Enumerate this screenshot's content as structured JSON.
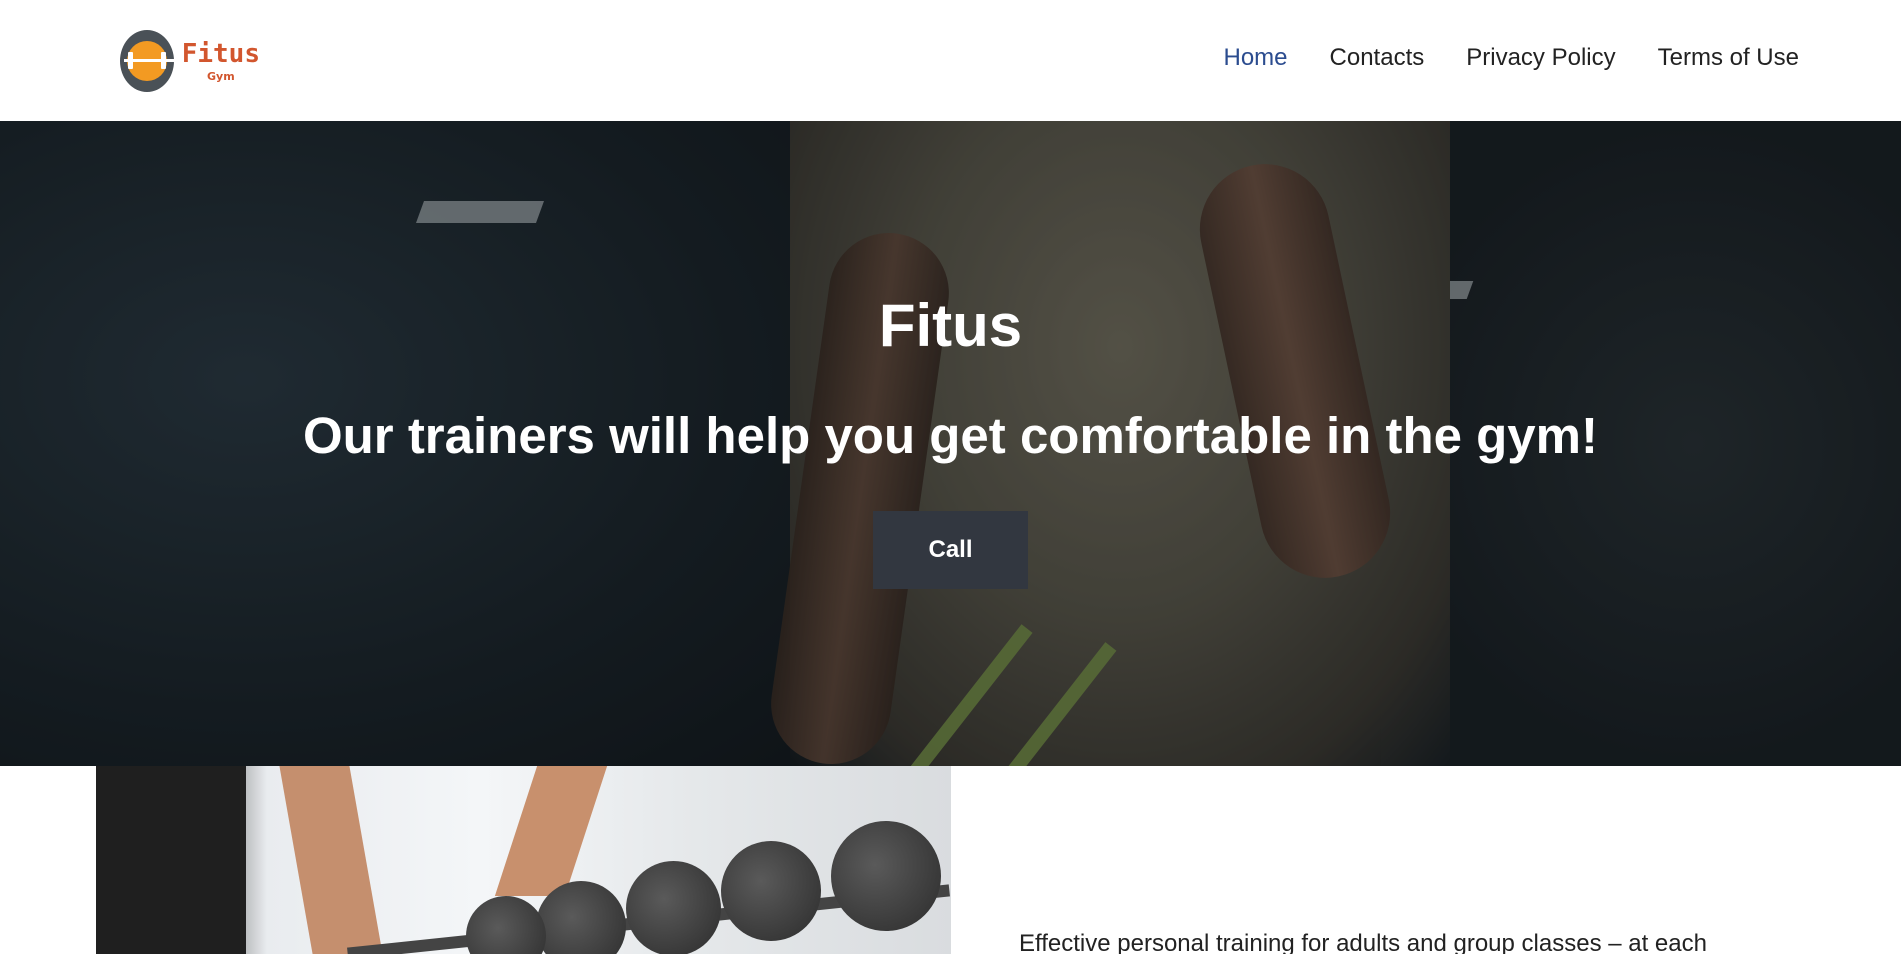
{
  "header": {
    "logo": {
      "name": "Fitus",
      "sub": "Gym"
    },
    "nav": [
      {
        "label": "Home",
        "active": true
      },
      {
        "label": "Contacts",
        "active": false
      },
      {
        "label": "Privacy Policy",
        "active": false
      },
      {
        "label": "Terms of Use",
        "active": false
      }
    ]
  },
  "hero": {
    "title": "Fitus",
    "subtitle": "Our trainers will help you get comfortable in the gym!",
    "button_label": "Call"
  },
  "content": {
    "intro_text": "Effective personal training for adults and group classes – at each"
  },
  "colors": {
    "nav_active": "#2b4c8f",
    "logo_accent": "#d2562e",
    "button_bg": "#323740"
  }
}
